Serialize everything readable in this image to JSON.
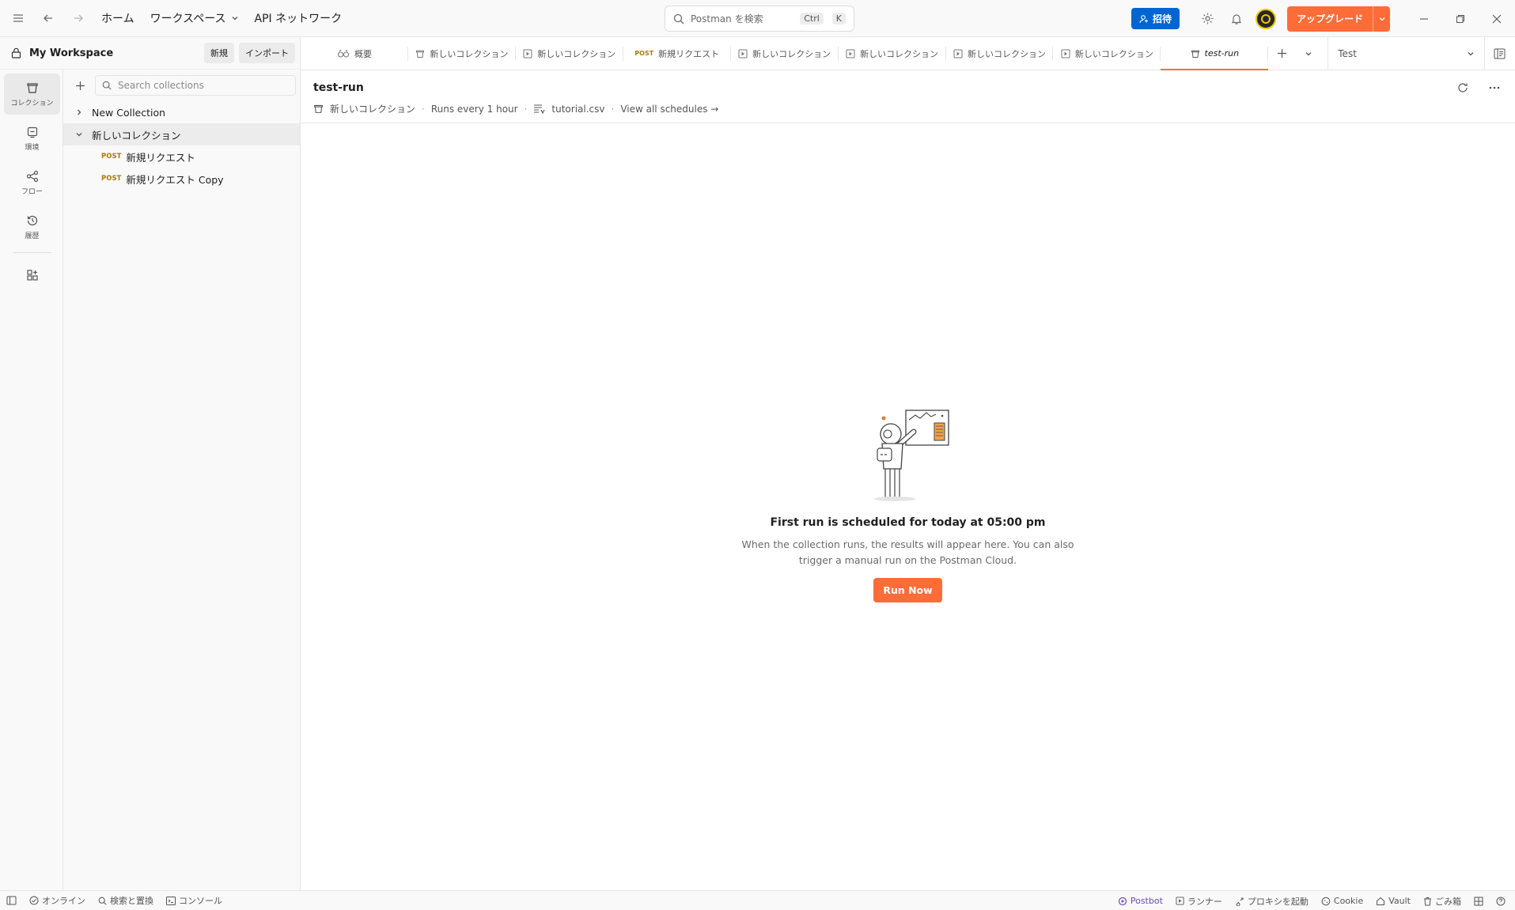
{
  "topbar": {
    "home": "ホーム",
    "workspaces": "ワークスペース",
    "api_network": "API ネットワーク",
    "search_placeholder": "Postman を検索",
    "shortcut_ctrl": "Ctrl",
    "shortcut_k": "K",
    "invite": "招待",
    "upgrade": "アップグレード"
  },
  "workspace": {
    "name": "My Workspace",
    "new_btn": "新規",
    "import_btn": "インポート"
  },
  "rail": [
    {
      "label": "コレクション",
      "icon": "collection-icon",
      "active": true
    },
    {
      "label": "環境",
      "icon": "environment-icon",
      "active": false
    },
    {
      "label": "フロー",
      "icon": "flows-icon",
      "active": false
    },
    {
      "label": "履歴",
      "icon": "history-icon",
      "active": false
    }
  ],
  "sidebar": {
    "search_placeholder": "Search collections",
    "tree": [
      {
        "label": "New Collection",
        "expanded": false
      },
      {
        "label": "新しいコレクション",
        "expanded": true
      },
      {
        "method": "POST",
        "label": "新規リクエスト"
      },
      {
        "method": "POST",
        "label": "新規リクエスト Copy"
      }
    ]
  },
  "tabs": [
    {
      "label": "概要",
      "icon": "overview-icon"
    },
    {
      "label": "新しいコレクション",
      "icon": "collection-icon"
    },
    {
      "label": "新しいコレクション",
      "icon": "runner-icon"
    },
    {
      "label": "新規リクエスト",
      "method": "POST"
    },
    {
      "label": "新しいコレクション",
      "icon": "runner-icon"
    },
    {
      "label": "新しいコレクション",
      "icon": "runner-icon"
    },
    {
      "label": "新しいコレクション",
      "icon": "runner-icon"
    },
    {
      "label": "新しいコレクション",
      "icon": "runner-icon"
    },
    {
      "label": "test-run",
      "icon": "collection-icon",
      "active": true
    }
  ],
  "environment": {
    "selected": "Test"
  },
  "run": {
    "title": "test-run",
    "collection": "新しいコレクション",
    "frequency": "Runs every 1 hour",
    "data_file": "tutorial.csv",
    "view_all": "View all schedules →"
  },
  "empty_state": {
    "heading": "First run is scheduled for today at 05:00 pm",
    "description": "When the collection runs, the results will appear here. You can also trigger a manual run on the Postman Cloud.",
    "button": "Run Now"
  },
  "statusbar": {
    "online": "オンライン",
    "find_replace": "検索と置換",
    "console": "コンソール",
    "postbot": "Postbot",
    "runner": "ランナー",
    "proxy": "プロキシを起動",
    "cookies": "Cookie",
    "vault": "Vault",
    "trash": "ごみ箱"
  },
  "colors": {
    "accent": "#ff6c37",
    "primary": "#0265d2",
    "method_post": "#ad7a03"
  }
}
